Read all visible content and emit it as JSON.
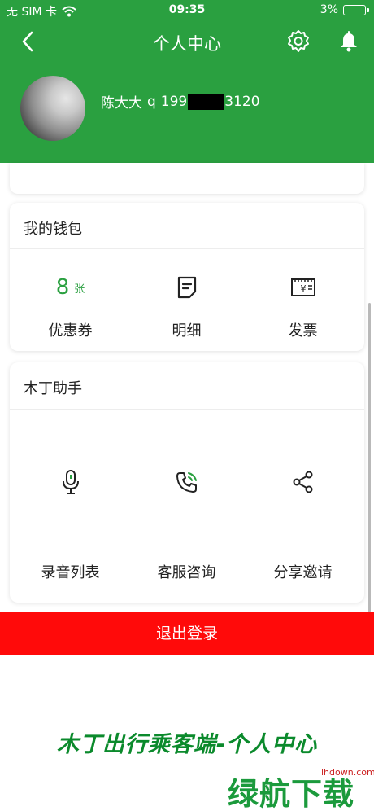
{
  "status_bar": {
    "carrier": "无 SIM 卡",
    "time": "09:35",
    "battery": "3%"
  },
  "nav": {
    "title": "个人中心"
  },
  "user": {
    "name": "陈大大",
    "prefix": "q",
    "phone_start": "199",
    "phone_end": "3120"
  },
  "wallet": {
    "title": "我的钱包",
    "items": [
      {
        "value": "8",
        "unit": "张",
        "label": "优惠券",
        "icon": "coupon"
      },
      {
        "label": "明细",
        "icon": "detail-icon"
      },
      {
        "label": "发票",
        "icon": "invoice-icon"
      }
    ]
  },
  "assistant": {
    "title": "木丁助手",
    "items": [
      {
        "label": "录音列表",
        "icon": "microphone-icon"
      },
      {
        "label": "客服咨询",
        "icon": "phone-icon"
      },
      {
        "label": "分享邀请",
        "icon": "share-icon"
      }
    ]
  },
  "logout_label": "退出登录",
  "watermark": {
    "caption": "木丁出行乘客端-个人中心",
    "site": "lhdown.com",
    "logo": "绿航下载"
  },
  "colors": {
    "primary": "#2aa040",
    "logout": "#ff0a0a"
  }
}
